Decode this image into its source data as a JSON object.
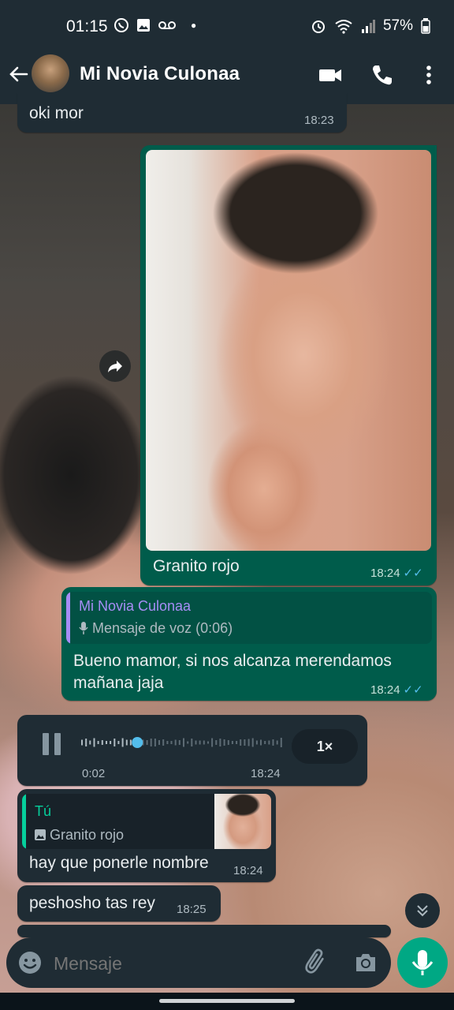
{
  "status": {
    "time": "01:15",
    "battery": "57%",
    "left_icons": [
      "whatsapp-icon",
      "gallery-icon",
      "voicemail-icon",
      "dot-icon"
    ],
    "right_icons": [
      "alarm-icon",
      "wifi-icon",
      "signal-icon",
      "battery-icon"
    ]
  },
  "header": {
    "contact_name": "Mi Novia Culonaa",
    "icons": [
      "back-arrow-icon",
      "video-call-icon",
      "phone-icon",
      "more-vert-icon"
    ]
  },
  "messages": {
    "m1": {
      "text": "oki mor",
      "time": "18:23"
    },
    "m2": {
      "caption": "Granito rojo",
      "time": "18:24",
      "ticks": "✓✓"
    },
    "m3": {
      "quote_author": "Mi Novia Culonaa",
      "quote_text": "Mensaje de voz (0:06)",
      "text": "Bueno mamor, si nos alcanza merendamos mañana jaja",
      "time": "18:24",
      "ticks": "✓✓"
    },
    "m4": {
      "duration": "0:02",
      "time": "18:24",
      "speed": "1×",
      "progress": 0.28
    },
    "m5": {
      "quote_author": "Tú",
      "quote_text": "Granito rojo",
      "text": "hay que ponerle nombre",
      "time": "18:24"
    },
    "m6": {
      "text": "peshosho tas rey",
      "time": "18:25"
    }
  },
  "input": {
    "placeholder": "Mensaje",
    "icons": [
      "emoji-icon",
      "attach-icon",
      "camera-icon",
      "mic-icon"
    ]
  },
  "colors": {
    "header_bg": "#1f2c34",
    "incoming_bubble": "#1f2c34",
    "outgoing_bubble": "#005c4b",
    "accent": "#00a884",
    "read_ticks": "#53bdeb",
    "quote_author_incoming": "#a68df5",
    "quote_author_outgoing": "#06cf9c"
  }
}
